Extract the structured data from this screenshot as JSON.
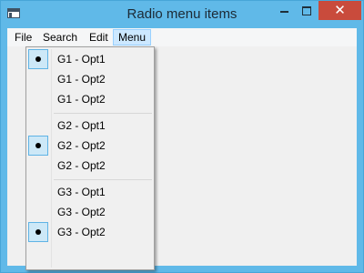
{
  "window": {
    "title": "Radio menu items",
    "minimize": "",
    "maximize": "",
    "close": "✕"
  },
  "menubar": {
    "items": [
      {
        "label": "File"
      },
      {
        "label": "Search"
      },
      {
        "label": "Edit"
      },
      {
        "label": "Menu"
      }
    ]
  },
  "dropdown": {
    "items": [
      {
        "label": "G1 - Opt1",
        "checked": true
      },
      {
        "label": "G1 - Opt2",
        "checked": false
      },
      {
        "label": "G1 - Opt2",
        "checked": false
      },
      {
        "label": "G2 - Opt1",
        "checked": false
      },
      {
        "label": "G2 - Opt2",
        "checked": true
      },
      {
        "label": "G2 - Opt2",
        "checked": false
      },
      {
        "label": "G3 - Opt1",
        "checked": false
      },
      {
        "label": "G3 - Opt2",
        "checked": false
      },
      {
        "label": "G3 - Opt2",
        "checked": true
      }
    ]
  },
  "colors": {
    "titlebar": "#60b9e8",
    "close_button": "#c94b3c",
    "menu_highlight": "#cce8ff",
    "check_background": "#cde8f7"
  }
}
